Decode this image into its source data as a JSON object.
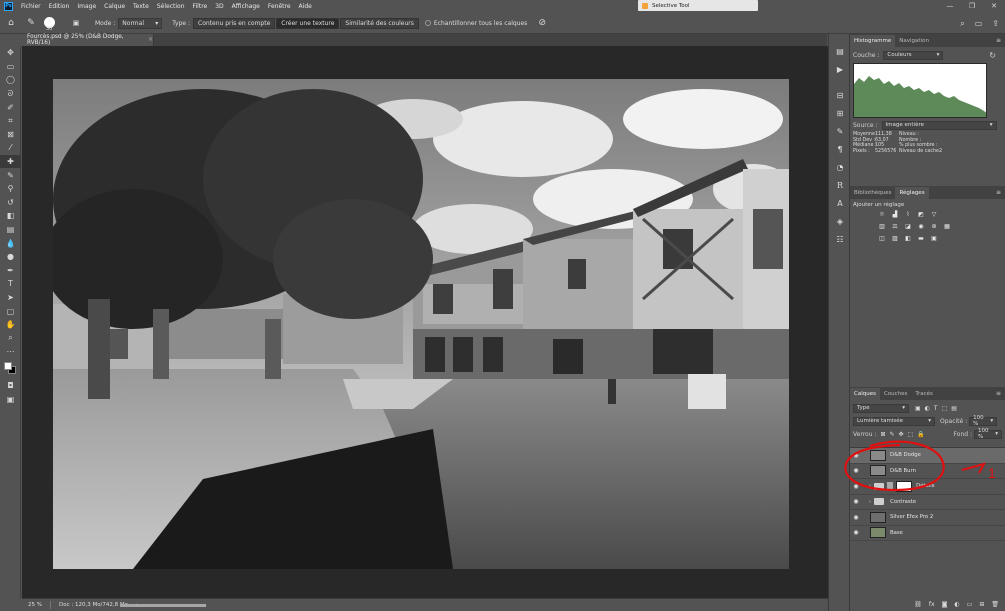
{
  "menubar": {
    "logo": "Ps",
    "items": [
      "Fichier",
      "Edition",
      "Image",
      "Calque",
      "Texte",
      "Sélection",
      "Filtre",
      "3D",
      "Affichage",
      "Fenêtre",
      "Aide"
    ],
    "floating_window": "Selective Tool",
    "window_controls": [
      "—",
      "❐",
      "✕"
    ]
  },
  "options": {
    "brush_size": "30",
    "mode_label": "Mode :",
    "mode_value": "Normal",
    "type_label": "Type :",
    "type_buttons": [
      "Contenu pris en compte",
      "Créer une texture",
      "Similarité des couleurs"
    ],
    "sample_all_label": "Echantillonner tous les calques"
  },
  "document": {
    "tab_title": "Fourcès.psd @ 25% (D&B Dodge, RVB/16)",
    "close": "×"
  },
  "status": {
    "zoom": "25 %",
    "doc_info": "Doc : 120,3 Mo/742,8 Mo",
    "arrow": "›"
  },
  "histogram_panel": {
    "tabs": [
      "Histogramme",
      "Navigation"
    ],
    "channel_label": "Couche :",
    "channel_value": "Couleurs",
    "source_label": "Source :",
    "source_value": "Image entière",
    "stats": [
      {
        "label": "Moyenne :",
        "value": "111,38",
        "label2": "Niveau :",
        "value2": ""
      },
      {
        "label": "Std Dev :",
        "value": "63,07",
        "label2": "Nombre :",
        "value2": ""
      },
      {
        "label": "Médiane :",
        "value": "105",
        "label2": "% plus sombre :",
        "value2": ""
      },
      {
        "label": "Pixels :",
        "value": "5256576",
        "label2": "Niveau de cache :",
        "value2": "2"
      }
    ],
    "color": "#5e8a5a"
  },
  "adjustments_panel": {
    "tabs": [
      "Bibliothèques",
      "Réglages"
    ],
    "add_label": "Ajouter un réglage",
    "row1_icons": [
      "brightness-contrast-icon",
      "levels-icon",
      "curves-icon",
      "exposure-icon",
      "vibrance-icon"
    ],
    "row2_icons": [
      "hue-saturation-icon",
      "color-balance-icon",
      "black-white-icon",
      "photo-filter-icon",
      "channel-mixer-icon",
      "color-lookup-icon"
    ],
    "row3_icons": [
      "invert-icon",
      "posterize-icon",
      "threshold-icon",
      "gradient-map-icon",
      "selective-color-icon"
    ]
  },
  "layers_panel": {
    "tabs": [
      "Calques",
      "Couches",
      "Tracés"
    ],
    "filter_value": "Type",
    "blend_mode": "Lumière tamisée",
    "opacity_label": "Opacité :",
    "opacity_value": "100 %",
    "lock_label": "Verrou :",
    "fill_label": "Fond :",
    "fill_value": "100 %",
    "layers": [
      {
        "name": "D&B Dodge",
        "kind": "layer",
        "selected": true
      },
      {
        "name": "D&B Burn",
        "kind": "layer",
        "selected": false
      },
      {
        "name": "Détails",
        "kind": "group-mask",
        "selected": false
      },
      {
        "name": "Contraste",
        "kind": "group",
        "selected": false
      },
      {
        "name": "Silver Efex Pro 2",
        "kind": "layer",
        "selected": false
      },
      {
        "name": "Base",
        "kind": "layer",
        "selected": false
      }
    ],
    "footer_icons": [
      "link-icon",
      "fx-icon",
      "mask-icon",
      "adjustment-icon",
      "group-icon",
      "new-layer-icon",
      "trash-icon"
    ]
  },
  "annotation": {
    "number": "1",
    "color": "#e01010"
  }
}
